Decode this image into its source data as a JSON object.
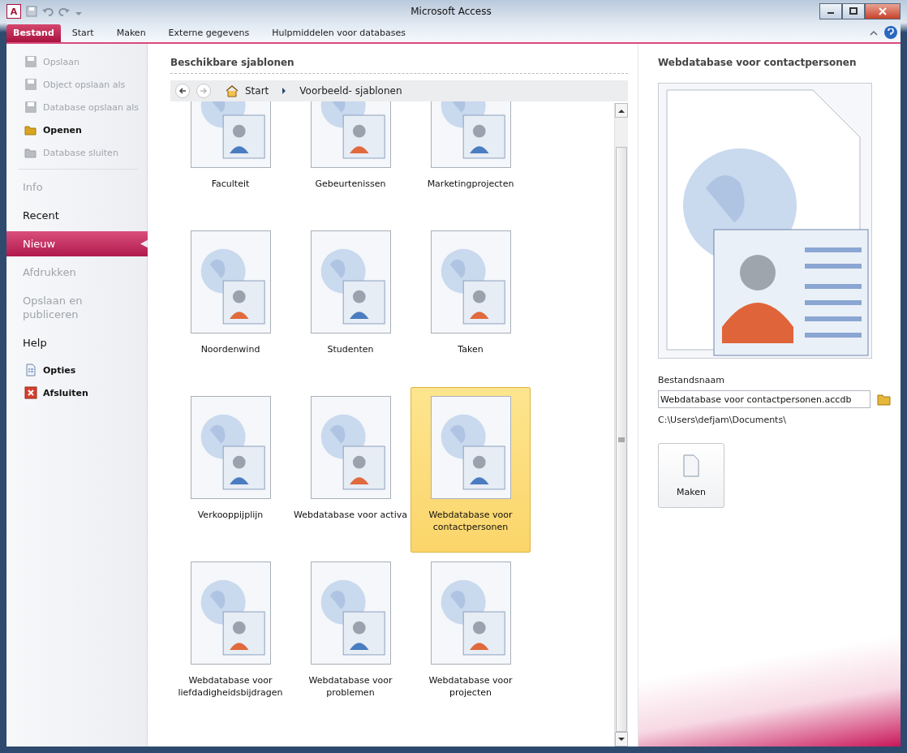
{
  "window": {
    "title": "Microsoft Access",
    "app_icon_letter": "A"
  },
  "ribbon_tabs": [
    {
      "label": "Bestand",
      "selected": true
    },
    {
      "label": "Start",
      "selected": false
    },
    {
      "label": "Maken",
      "selected": false
    },
    {
      "label": "Externe gegevens",
      "selected": false
    },
    {
      "label": "Hulpmiddelen voor databases",
      "selected": false
    }
  ],
  "sidebar": {
    "items": [
      {
        "kind": "command",
        "label": "Opslaan",
        "disabled": true
      },
      {
        "kind": "command",
        "label": "Object opslaan als",
        "disabled": true
      },
      {
        "kind": "command",
        "label": "Database opslaan als",
        "disabled": true
      },
      {
        "kind": "command",
        "label": "Openen",
        "disabled": false
      },
      {
        "kind": "command",
        "label": "Database sluiten",
        "disabled": true
      },
      {
        "kind": "divider"
      },
      {
        "kind": "section",
        "label": "Info",
        "disabled": true,
        "selected": false
      },
      {
        "kind": "section",
        "label": "Recent",
        "disabled": false,
        "selected": false
      },
      {
        "kind": "section",
        "label": "Nieuw",
        "disabled": false,
        "selected": true
      },
      {
        "kind": "section",
        "label": "Afdrukken",
        "disabled": true,
        "selected": false
      },
      {
        "kind": "section",
        "label": "Opslaan en publiceren",
        "disabled": true,
        "selected": false
      },
      {
        "kind": "section",
        "label": "Help",
        "disabled": false,
        "selected": false
      },
      {
        "kind": "command",
        "label": "Opties",
        "disabled": false
      },
      {
        "kind": "command",
        "label": "Afsluiten",
        "disabled": false
      }
    ]
  },
  "templates": {
    "title": "Beschikbare sjablonen",
    "breadcrumb": [
      "Start",
      "Voorbeeld- sjablonen"
    ],
    "items": [
      {
        "label": "Faculteit",
        "selected": false
      },
      {
        "label": "Gebeurtenissen",
        "selected": false
      },
      {
        "label": "Marketingprojecten",
        "selected": false
      },
      {
        "label": "Noordenwind",
        "selected": false
      },
      {
        "label": "Studenten",
        "selected": false
      },
      {
        "label": "Taken",
        "selected": false
      },
      {
        "label": "Verkooppijplijn",
        "selected": false
      },
      {
        "label": "Webdatabase voor activa",
        "selected": false
      },
      {
        "label": "Webdatabase voor contactpersonen",
        "selected": true
      },
      {
        "label": "Webdatabase voor liefdadigheidsbijdragen",
        "selected": false
      },
      {
        "label": "Webdatabase voor problemen",
        "selected": false
      },
      {
        "label": "Webdatabase voor projecten",
        "selected": false
      }
    ]
  },
  "details": {
    "title": "Webdatabase voor contactpersonen",
    "filename_label": "Bestandsnaam",
    "filename": "Webdatabase voor contactpersonen.accdb",
    "path": "C:\\Users\\defjam\\Documents\\",
    "create_button": "Maken"
  }
}
